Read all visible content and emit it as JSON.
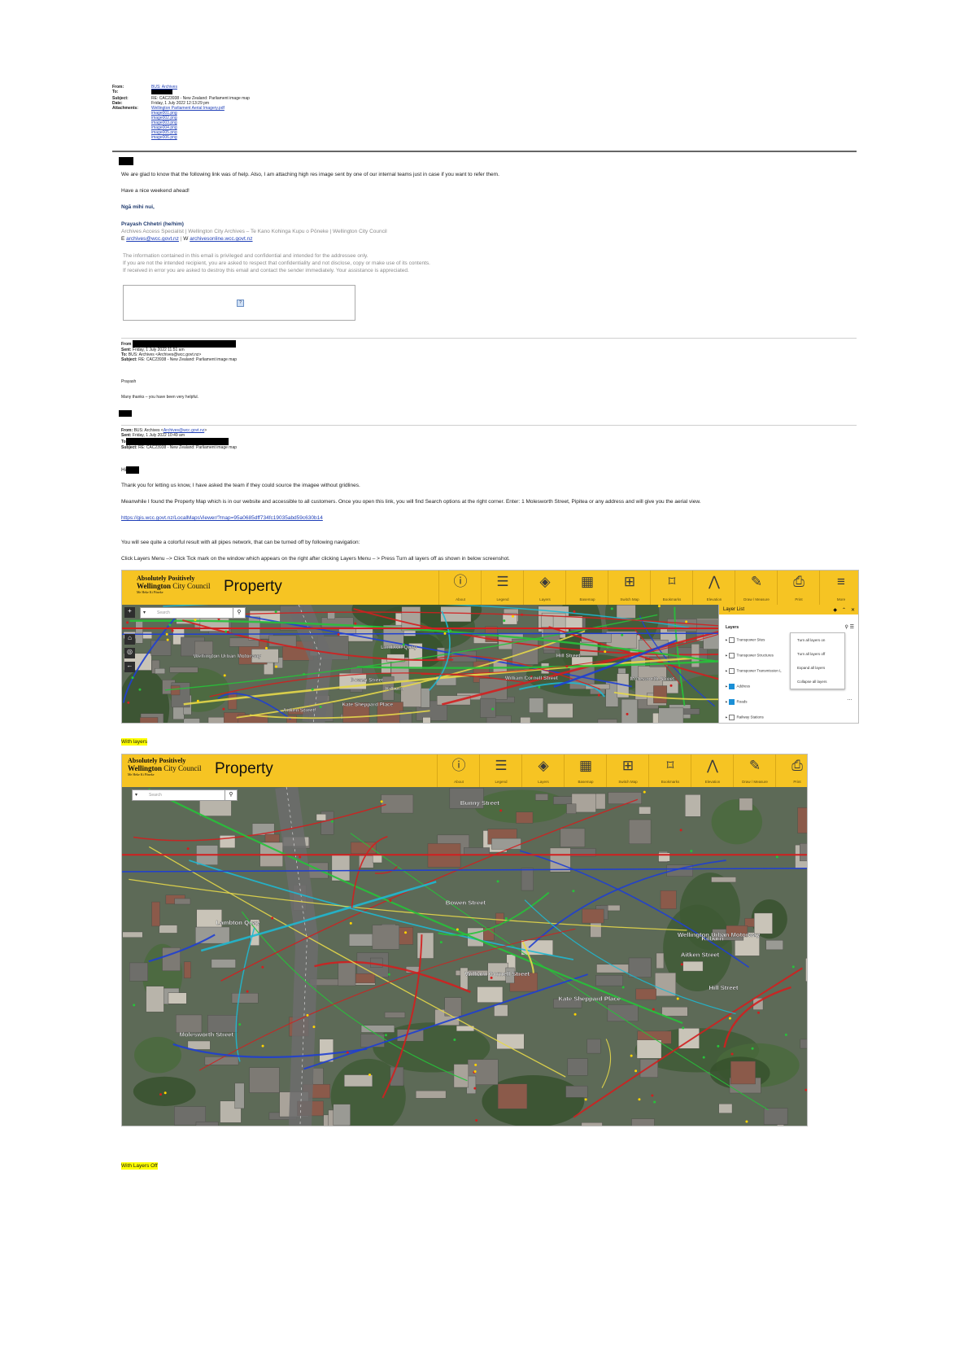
{
  "email_header": {
    "from_label": "From:",
    "from_value": "BUS: Archives",
    "to_label": "To:",
    "subject_label": "Subject:",
    "subject_value": "RE: CAC23938 - New Zealand: Parliament image map",
    "date_label": "Date:",
    "date_value": "Friday, 1 July 2022 12:13:29 pm",
    "attachments_label": "Attachments:",
    "attachments": [
      "Wellington Parliament Aerial Imagery.pdf",
      "image001.png",
      "image002.png",
      "image003.png",
      "image004.png",
      "image005.png",
      "image006.png"
    ]
  },
  "body": {
    "line1": "We are glad to know that the following link was of help. Also, I am attaching high res image sent by one of our internal teams just in case if you want to refer them.",
    "line2": "Have a nice weekend ahead!",
    "signoff": "Ngā mihi nui,",
    "sig_name": "Prayash Chhetri (he/him)",
    "sig_title": "Archives Access Specialist | Wellington City Archives – Te Kano Kohinga Kupu o Pōneke | Wellington City Council",
    "sig_e_label": "E",
    "sig_email": "archives@wcc.govt.nz",
    "sig_sep": "|",
    "sig_w_label": "W",
    "sig_web": "archivesonline.wcc.govt.nz",
    "disclaimer1": "The information contained in this email is privileged and confidential and intended for the addressee only.",
    "disclaimer2": "If you are not the intended recipient, you are asked to respect that confidentiality and not disclose, copy or make use of its contents.",
    "disclaimer3": "If received in error you are asked to destroy this email and contact the sender immediately. Your assistance is appreciated.",
    "image_placeholder": "?"
  },
  "reply1": {
    "from_label": "From",
    "sent_label": "Sent:",
    "sent_value": "Friday, 1 July 2022 11:51 am",
    "to_label": "To:",
    "to_value": "BUS: Archives <Archives@wcc.govt.nz>",
    "subject_label": "Subject:",
    "subject_value": "RE: CAC23938 - New Zealand: Parliament image map",
    "greeting": "Prayash",
    "text": "Many thanks – you have been very helpful."
  },
  "reply2": {
    "from_label": "From:",
    "from_value_prefix": "BUS: Archives <",
    "from_value_link": "Archives@wcc.govt.nz",
    "from_value_suffix": ">",
    "sent_label": "Sent:",
    "sent_value": "Friday, 1 July 2022 10:49 am",
    "to_label": "To",
    "subject_label": "Subject:",
    "subject_value": "RE: CAC23938 - New Zealand: Parliament image map",
    "greeting": "Hi",
    "p1": "Thank you for letting us know, I have asked the team if they could source the imagee without gridlines.",
    "p2": "Meanwhile I found the Property Map which is in our website and accessible to all customers. Once you open this link, you will find Search options at the right corner. Enter: 1 Molesworth Street, Pipitea or any address and will give you the aerial view.",
    "link": "https://gis.wcc.govt.nz/LocalMapsViewer/?map=95a0685dff734fc19035abd59c630b14",
    "p3": "You will see quite a colorful result with all pipes network, that can be turned off by following navigation:",
    "p4": "Click Layers Menu –> Click Tick mark on the window which appears on the right after clicking Layers Menu – > Press Turn all layers off as shown in below screenshot."
  },
  "map_app": {
    "logo_line1": "Absolutely Positively",
    "logo_line2a": "Wellington",
    "logo_line2b": " City Council",
    "logo_line3": "Me Heke Ki Pōneke",
    "title": "Property",
    "tools": [
      "About",
      "Legend",
      "Layers",
      "Basemap",
      "Switch Map",
      "Bookmarks",
      "Elevation",
      "Draw / Measure",
      "Print",
      "More"
    ],
    "search_placeholder": "Search",
    "layer_panel": {
      "title": "Layer List",
      "section": "Layers",
      "rows": [
        {
          "label": "Transpower Sites",
          "checked": false
        },
        {
          "label": "Transpower Structures",
          "checked": false
        },
        {
          "label": "Transpower Transmission L",
          "checked": false
        },
        {
          "label": "Address",
          "checked": true
        },
        {
          "label": "Roads",
          "checked": true
        },
        {
          "label": "Railway Stations",
          "checked": false
        }
      ],
      "menu": [
        "Turn all layers on",
        "Turn all layers off",
        "Expand all layers",
        "Collapse all layers"
      ]
    },
    "street_labels": [
      "Hill Street",
      "Aitken Street",
      "Molesworth Street",
      "William Cornell Street",
      "Kate Sheppard Place",
      "Bowen Street",
      "Lambton Quay",
      "Wellington Urban Motorway",
      "Bunny Street",
      "Kilburn"
    ]
  },
  "captions": {
    "caption1": "With layers",
    "caption2": "With Layers Off"
  },
  "colors": {
    "brand_yellow": "#f6c423",
    "highlight": "#ffff00",
    "link_blue": "#1f3fb8",
    "navy": "#1f3a6e"
  }
}
